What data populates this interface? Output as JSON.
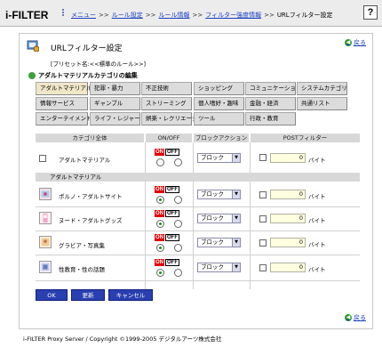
{
  "header": {
    "logo": "i-FILTER",
    "breadcrumbs": [
      "メニュー",
      "ルール設定",
      "ルール情報",
      "フィルター強度情報"
    ],
    "current": "URLフィルター設定",
    "help": "?"
  },
  "page": {
    "title": "URLフィルター設定",
    "back_label": "戻る",
    "preset": "[プリセット名:<<標準のルール>>]",
    "section_title": "アダルトマテリアルカテゴリの編集"
  },
  "tabs": [
    {
      "label": "アダルトマテリアル",
      "active": true
    },
    {
      "label": "犯罪・暴力"
    },
    {
      "label": "不正技術"
    },
    {
      "label": "ショッピング"
    },
    {
      "label": "コミュニケーション"
    },
    {
      "label": "システムカテゴリ"
    },
    {
      "label": "情報サービス"
    },
    {
      "label": "ギャンブル"
    },
    {
      "label": "ストリーミング"
    },
    {
      "label": "個人嗜好・趣味"
    },
    {
      "label": "金融・経済"
    },
    {
      "label": "共通リスト"
    },
    {
      "label": "エンターテイメント"
    },
    {
      "label": "ライフ・レジャー"
    },
    {
      "label": "娯楽・レクリエーション"
    },
    {
      "label": "ツール"
    },
    {
      "label": "行政・教育"
    }
  ],
  "table": {
    "headers": {
      "category": "カテゴリ全体",
      "onoff": "ON/OFF",
      "action": "ブロックアクション",
      "post": "POSTフィルター"
    },
    "on_label": "ON",
    "off_label": "OFF",
    "unit": "バイト",
    "parent_row": {
      "label": "アダルトマテリアル",
      "action": "ブロック",
      "post_value": "0"
    },
    "sub_header": "アダルトマテリアル",
    "rows": [
      {
        "label": "ポルノ・アダルトサイト",
        "action": "ブロック",
        "post_value": "0",
        "state": "on"
      },
      {
        "label": "ヌード・アダルトグッズ",
        "action": "ブロック",
        "post_value": "0",
        "state": "on"
      },
      {
        "label": "グラビア・写真集",
        "action": "ブロック",
        "post_value": "0",
        "state": "on"
      },
      {
        "label": "性教育・性の話題",
        "action": "ブロック",
        "post_value": "0",
        "state": "on"
      }
    ]
  },
  "buttons": {
    "ok": "OK",
    "update": "更新",
    "cancel": "キャンセル"
  },
  "footer": "i-FILTER Proxy Server / Copyright ©1999-2005 デジタルアーツ株式会社",
  "colors": {
    "on": "#e00000",
    "accent_blue": "#2a3fb0",
    "input_bg": "#ffffe0"
  }
}
